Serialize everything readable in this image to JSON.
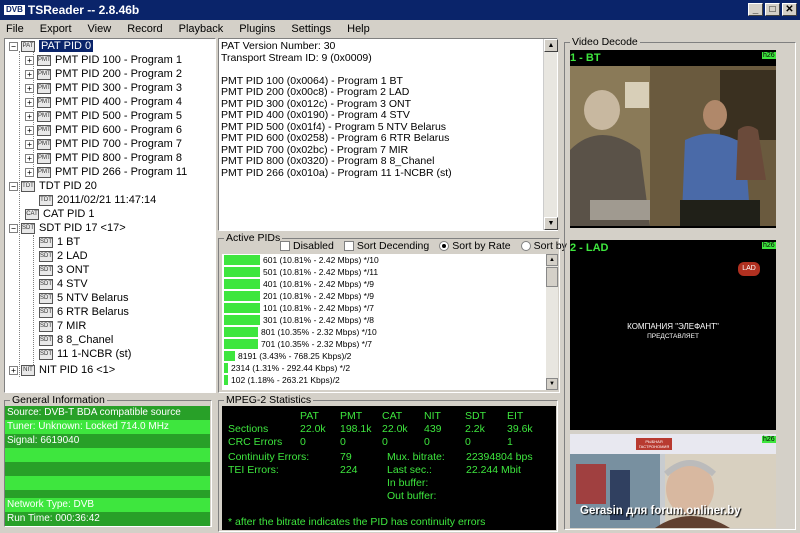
{
  "app": {
    "title": "TSReader -- 2.8.46b",
    "logo": "DVB"
  },
  "window_buttons": [
    "_",
    "□",
    "✕"
  ],
  "menu": [
    "File",
    "Export",
    "View",
    "Record",
    "Playback",
    "Plugins",
    "Settings",
    "Help"
  ],
  "tree": {
    "pat": "PAT PID 0",
    "pmts": [
      "PMT PID 100 - Program 1",
      "PMT PID 200 - Program 2",
      "PMT PID 300 - Program 3",
      "PMT PID 400 - Program 4",
      "PMT PID 500 - Program 5",
      "PMT PID 600 - Program 6",
      "PMT PID 700 - Program 7",
      "PMT PID 800 - Program 8",
      "PMT PID 266 - Program 11"
    ],
    "tdt": "TDT PID 20",
    "tdt_time": "2011/02/21 11:47:14",
    "cat": "CAT PID 1",
    "sdt": "SDT PID 17 <17>",
    "services": [
      "1 BT",
      "2 LAD",
      "3 ONT",
      "4 STV",
      "5 NTV Belarus",
      "6 RTR Belarus",
      "7 MIR",
      "8 8_Chanel",
      "11 1-NCBR (st)"
    ],
    "nit": "NIT PID 16 <1>",
    "expanders": {
      "plus": "+",
      "minus": "−"
    }
  },
  "pat_info": [
    "PAT Version Number: 30",
    "Transport Stream ID: 9 (0x0009)",
    "",
    "PMT PID 100 (0x0064) - Program 1 BT",
    "PMT PID 200 (0x00c8) - Program 2 LAD",
    "PMT PID 300 (0x012c) - Program 3 ONT",
    "PMT PID 400 (0x0190) - Program 4 STV",
    "PMT PID 500 (0x01f4) - Program 5 NTV Belarus",
    "PMT PID 600 (0x0258) - Program 6 RTR Belarus",
    "PMT PID 700 (0x02bc) - Program 7 MIR",
    "PMT PID 800 (0x0320) - Program 8 8_Chanel",
    "PMT PID 266 (0x010a) - Program 11 1-NCBR (st)"
  ],
  "active_pids": {
    "label": "Active PIDs",
    "options": {
      "disabled": "Disabled",
      "sort_desc": "Sort Decending",
      "sort_rate": "Sort by Rate",
      "sort_pid": "Sort by PID"
    },
    "rows": [
      {
        "text": "601 (10.81% - 2.42 Mbps) */10",
        "pct": 10.81
      },
      {
        "text": "501 (10.81% - 2.42 Mbps) */11",
        "pct": 10.81
      },
      {
        "text": "401 (10.81% - 2.42 Mbps) */9",
        "pct": 10.81
      },
      {
        "text": "201 (10.81% - 2.42 Mbps) */9",
        "pct": 10.81
      },
      {
        "text": "101 (10.81% - 2.42 Mbps) */7",
        "pct": 10.81
      },
      {
        "text": "301 (10.81% - 2.42 Mbps) */8",
        "pct": 10.81
      },
      {
        "text": "801 (10.35% - 2.32 Mbps) */10",
        "pct": 10.35
      },
      {
        "text": "701 (10.35% - 2.32 Mbps) */7",
        "pct": 10.35
      },
      {
        "text": "8191 (3.43% - 768.25 Kbps)/2",
        "pct": 3.43
      },
      {
        "text": "2314 (1.31% - 292.44 Kbps) */2",
        "pct": 1.31
      },
      {
        "text": "102 (1.18% - 263.21 Kbps)/2",
        "pct": 1.18
      }
    ]
  },
  "general": {
    "label": "General Information",
    "lines": [
      "Source: DVB-T BDA compatible source",
      "Tuner: Unknown: Locked 714.0 MHz",
      "Signal: 6619040",
      "",
      "",
      "",
      "",
      "Network Type: DVB",
      "Run Time: 000:36:42"
    ]
  },
  "mpeg": {
    "label": "MPEG-2 Statistics",
    "headers": [
      "PAT",
      "PMT",
      "CAT",
      "NIT",
      "SDT",
      "EIT"
    ],
    "sections_label": "Sections",
    "sections": [
      "22.0k",
      "198.1k",
      "22.0k",
      "439",
      "2.2k",
      "39.6k"
    ],
    "crc_label": "CRC Errors",
    "crc": [
      "0",
      "0",
      "0",
      "0",
      "0",
      "1"
    ],
    "continuity_label": "Continuity Errors:",
    "continuity": "79",
    "tei_label": "TEI Errors:",
    "tei": "224",
    "mux_label": "Mux. bitrate:",
    "mux": "22394804 bps",
    "last_label": "Last sec.:",
    "last": "22.244 Mbit",
    "inbuf_label": "In buffer:",
    "outbuf_label": "Out buffer:",
    "note": "* after the bitrate indicates the PID has continuity errors"
  },
  "video": {
    "label": "Video Decode",
    "panels": [
      {
        "label": "1 - BT",
        "badge": "h26"
      },
      {
        "label": "2 - LAD",
        "badge": "h26"
      },
      {
        "label": "",
        "badge": "h26"
      }
    ],
    "lad_caption": [
      "КОМПАНИЯ \"ЭЛЕФАНТ\"",
      "ПРЕДСТАВЛЯЕТ"
    ],
    "logo_text": "LAD",
    "store_sign": "РЫБНАЯ ГАСТРОНОМИЯ"
  },
  "watermark": "Gerasin для forum.onliner.by",
  "colors": {
    "green": "#3ee63e",
    "titlebar": "#0a246a"
  }
}
